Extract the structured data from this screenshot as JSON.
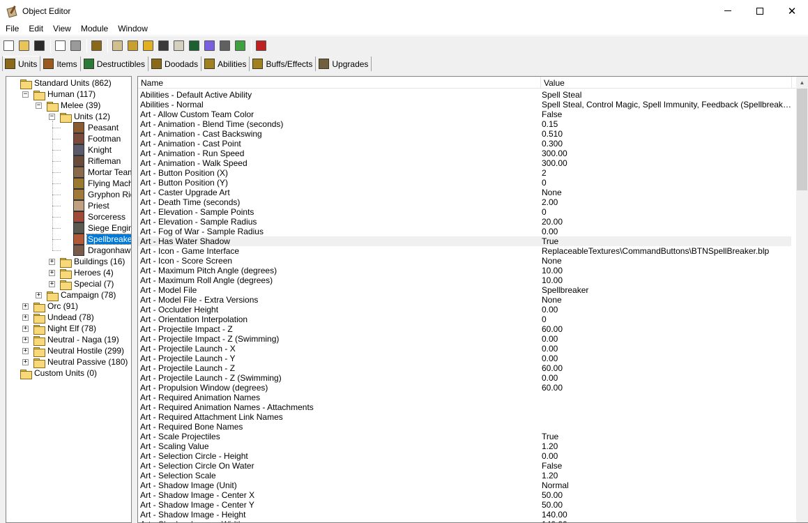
{
  "window": {
    "title": "Object Editor",
    "minimize": "—",
    "maximize": "☐",
    "close": "✕"
  },
  "menu": [
    "File",
    "Edit",
    "View",
    "Module",
    "Window"
  ],
  "toolbar": {
    "buttons": [
      {
        "name": "new-icon",
        "color": "#ffffff"
      },
      {
        "name": "open-folder-icon",
        "color": "#e8c45a"
      },
      {
        "name": "save-icon",
        "color": "#2a2a2a"
      },
      {
        "name": "copy-icon",
        "color": "#ffffff"
      },
      {
        "name": "paste-icon",
        "color": "#9a9a9a"
      },
      {
        "name": "unit-editor-icon",
        "color": "#8a6a1a"
      },
      {
        "name": "terrain-icon",
        "color": "#d0c090"
      },
      {
        "name": "doodad-icon",
        "color": "#c8a030"
      },
      {
        "name": "sound-icon",
        "color": "#e0b020"
      },
      {
        "name": "unit-palette-icon",
        "color": "#3a3a3a"
      },
      {
        "name": "region-icon",
        "color": "#d4d0c0"
      },
      {
        "name": "camera-icon",
        "color": "#1a6030"
      },
      {
        "name": "ai-icon",
        "color": "#7a60e0"
      },
      {
        "name": "object-icon",
        "color": "#606060"
      },
      {
        "name": "import-icon",
        "color": "#40a040"
      },
      {
        "name": "test-map-icon",
        "color": "#c02020"
      }
    ]
  },
  "tabs": [
    {
      "label": "Units",
      "icon": "units-tab-icon",
      "color": "#8a6a1a",
      "active": true
    },
    {
      "label": "Items",
      "icon": "items-tab-icon",
      "color": "#9a5a20"
    },
    {
      "label": "Destructibles",
      "icon": "destructibles-tab-icon",
      "color": "#2a7a3a"
    },
    {
      "label": "Doodads",
      "icon": "doodads-tab-icon",
      "color": "#8a6a1a"
    },
    {
      "label": "Abilities",
      "icon": "abilities-tab-icon",
      "color": "#a08020"
    },
    {
      "label": "Buffs/Effects",
      "icon": "buffs-tab-icon",
      "color": "#a08020"
    },
    {
      "label": "Upgrades",
      "icon": "upgrades-tab-icon",
      "color": "#706040"
    }
  ],
  "tree": [
    {
      "label": "Standard Units (862)",
      "level": 0,
      "type": "folder",
      "expander": ""
    },
    {
      "label": "Human (117)",
      "level": 1,
      "type": "folder",
      "expander": "−"
    },
    {
      "label": "Melee (39)",
      "level": 2,
      "type": "folder",
      "expander": "−"
    },
    {
      "label": "Units (12)",
      "level": 3,
      "type": "folder",
      "expander": "−"
    },
    {
      "label": "Peasant",
      "level": 4,
      "type": "unit",
      "color": "#8a5a30"
    },
    {
      "label": "Footman",
      "level": 4,
      "type": "unit",
      "color": "#7a4a3a"
    },
    {
      "label": "Knight",
      "level": 4,
      "type": "unit",
      "color": "#5a5a6a"
    },
    {
      "label": "Rifleman",
      "level": 4,
      "type": "unit",
      "color": "#6a4a3a"
    },
    {
      "label": "Mortar Team",
      "level": 4,
      "type": "unit",
      "color": "#8a6a4a"
    },
    {
      "label": "Flying Machine",
      "level": 4,
      "type": "unit",
      "color": "#9a7a30"
    },
    {
      "label": "Gryphon Rider",
      "level": 4,
      "type": "unit",
      "color": "#a07a3a"
    },
    {
      "label": "Priest",
      "level": 4,
      "type": "unit",
      "color": "#c0a080"
    },
    {
      "label": "Sorceress",
      "level": 4,
      "type": "unit",
      "color": "#a04a3a"
    },
    {
      "label": "Siege Engine",
      "level": 4,
      "type": "unit",
      "color": "#5a5a50"
    },
    {
      "label": "Spellbreaker",
      "level": 4,
      "type": "unit",
      "color": "#b05a3a",
      "selected": true
    },
    {
      "label": "Dragonhawk Rider",
      "level": 4,
      "type": "unit",
      "color": "#7a5a4a"
    },
    {
      "label": "Buildings (16)",
      "level": 3,
      "type": "folder",
      "expander": "+"
    },
    {
      "label": "Heroes (4)",
      "level": 3,
      "type": "folder",
      "expander": "+"
    },
    {
      "label": "Special (7)",
      "level": 3,
      "type": "folder",
      "expander": "+"
    },
    {
      "label": "Campaign (78)",
      "level": 2,
      "type": "folder",
      "expander": "+"
    },
    {
      "label": "Orc (91)",
      "level": 1,
      "type": "folder",
      "expander": "+"
    },
    {
      "label": "Undead (78)",
      "level": 1,
      "type": "folder",
      "expander": "+"
    },
    {
      "label": "Night Elf (78)",
      "level": 1,
      "type": "folder",
      "expander": "+"
    },
    {
      "label": "Neutral - Naga (19)",
      "level": 1,
      "type": "folder",
      "expander": "+"
    },
    {
      "label": "Neutral Hostile (299)",
      "level": 1,
      "type": "folder",
      "expander": "+"
    },
    {
      "label": "Neutral Passive (180)",
      "level": 1,
      "type": "folder",
      "expander": "+"
    },
    {
      "label": "Custom Units (0)",
      "level": 0,
      "type": "folder",
      "expander": ""
    }
  ],
  "grid": {
    "headers": {
      "name": "Name",
      "value": "Value"
    },
    "rows": [
      {
        "name": "Abilities - Default Active Ability",
        "value": "Spell Steal"
      },
      {
        "name": "Abilities - Normal",
        "value": "Spell Steal, Control Magic, Spell Immunity, Feedback (Spellbreaker), Unit ..."
      },
      {
        "name": "Art - Allow Custom Team Color",
        "value": "False"
      },
      {
        "name": "Art - Animation - Blend Time (seconds)",
        "value": "0.15"
      },
      {
        "name": "Art - Animation - Cast Backswing",
        "value": "0.510"
      },
      {
        "name": "Art - Animation - Cast Point",
        "value": "0.300"
      },
      {
        "name": "Art - Animation - Run Speed",
        "value": "300.00"
      },
      {
        "name": "Art - Animation - Walk Speed",
        "value": "300.00"
      },
      {
        "name": "Art - Button Position (X)",
        "value": "2"
      },
      {
        "name": "Art - Button Position (Y)",
        "value": "0"
      },
      {
        "name": "Art - Caster Upgrade Art",
        "value": "None"
      },
      {
        "name": "Art - Death Time (seconds)",
        "value": "2.00"
      },
      {
        "name": "Art - Elevation - Sample Points",
        "value": "0"
      },
      {
        "name": "Art - Elevation - Sample Radius",
        "value": "20.00"
      },
      {
        "name": "Art - Fog of War - Sample Radius",
        "value": "0.00"
      },
      {
        "name": "Art - Has Water Shadow",
        "value": "True",
        "hover": true
      },
      {
        "name": "Art - Icon - Game Interface",
        "value": "ReplaceableTextures\\CommandButtons\\BTNSpellBreaker.blp"
      },
      {
        "name": "Art - Icon - Score Screen",
        "value": "None"
      },
      {
        "name": "Art - Maximum Pitch Angle (degrees)",
        "value": "10.00"
      },
      {
        "name": "Art - Maximum Roll Angle (degrees)",
        "value": "10.00"
      },
      {
        "name": "Art - Model File",
        "value": "Spellbreaker"
      },
      {
        "name": "Art - Model File - Extra Versions",
        "value": "None"
      },
      {
        "name": "Art - Occluder Height",
        "value": "0.00"
      },
      {
        "name": "Art - Orientation Interpolation",
        "value": "0"
      },
      {
        "name": "Art - Projectile Impact - Z",
        "value": "60.00"
      },
      {
        "name": "Art - Projectile Impact - Z (Swimming)",
        "value": "0.00"
      },
      {
        "name": "Art - Projectile Launch - X",
        "value": "0.00"
      },
      {
        "name": "Art - Projectile Launch - Y",
        "value": "0.00"
      },
      {
        "name": "Art - Projectile Launch - Z",
        "value": "60.00"
      },
      {
        "name": "Art - Projectile Launch - Z (Swimming)",
        "value": "0.00"
      },
      {
        "name": "Art - Propulsion Window (degrees)",
        "value": "60.00"
      },
      {
        "name": "Art - Required Animation Names",
        "value": ""
      },
      {
        "name": "Art - Required Animation Names - Attachments",
        "value": ""
      },
      {
        "name": "Art - Required Attachment Link Names",
        "value": ""
      },
      {
        "name": "Art - Required Bone Names",
        "value": ""
      },
      {
        "name": "Art - Scale Projectiles",
        "value": "True"
      },
      {
        "name": "Art - Scaling Value",
        "value": "1.20"
      },
      {
        "name": "Art - Selection Circle - Height",
        "value": "0.00"
      },
      {
        "name": "Art - Selection Circle On Water",
        "value": "False"
      },
      {
        "name": "Art - Selection Scale",
        "value": "1.20"
      },
      {
        "name": "Art - Shadow Image (Unit)",
        "value": "Normal"
      },
      {
        "name": "Art - Shadow Image - Center X",
        "value": "50.00"
      },
      {
        "name": "Art - Shadow Image - Center Y",
        "value": "50.00"
      },
      {
        "name": "Art - Shadow Image - Height",
        "value": "140.00"
      },
      {
        "name": "Art - Shadow Image - Width",
        "value": "140.00"
      }
    ]
  }
}
